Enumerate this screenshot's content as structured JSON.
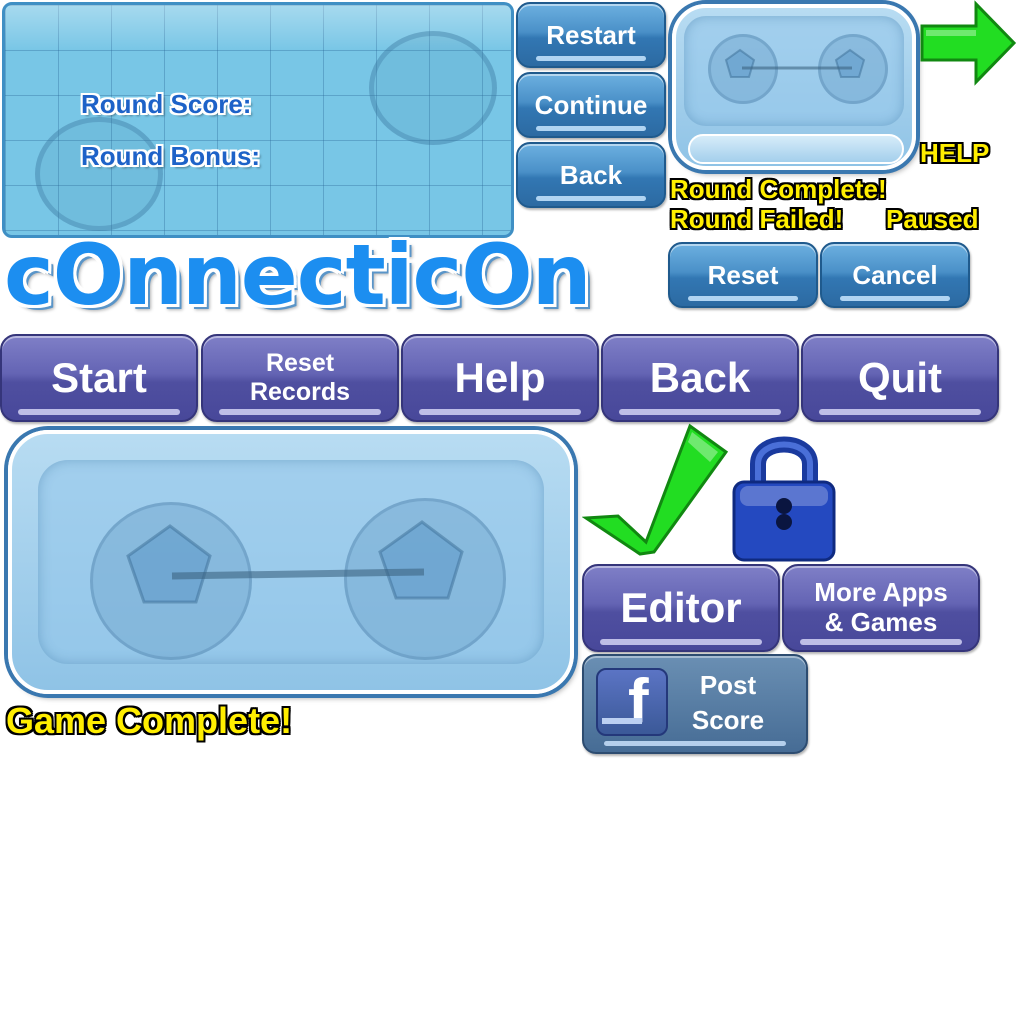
{
  "score_panel": {
    "round_score_label": "Round Score:",
    "round_bonus_label": "Round Bonus:"
  },
  "small_buttons": {
    "restart": "Restart",
    "continue": "Continue",
    "back": "Back",
    "reset": "Reset",
    "cancel": "Cancel"
  },
  "labels": {
    "help": "HELP",
    "round_complete": "Round Complete!",
    "round_failed": "Round Failed!",
    "paused": "Paused",
    "game_complete": "Game Complete!"
  },
  "logo": {
    "text": "cOnnecticOn"
  },
  "menu": {
    "start": "Start",
    "reset_records_line1": "Reset",
    "reset_records_line2": "Records",
    "help": "Help",
    "back": "Back",
    "quit": "Quit",
    "editor": "Editor",
    "more_apps_line1": "More Apps",
    "more_apps_line2": "& Games",
    "post_score_line1": "Post",
    "post_score_line2": "Score",
    "facebook_glyph": "f"
  },
  "colors": {
    "accent_blue": "#4a90c8",
    "button_purple": "#5a5aab",
    "label_yellow": "#ffee00",
    "logo_blue": "#1c8ef0",
    "arrow_green": "#22dd22",
    "lock_blue": "#1f3fb0"
  },
  "icons": [
    "arrow-right-icon",
    "checkmark-icon",
    "padlock-icon",
    "facebook-icon"
  ]
}
